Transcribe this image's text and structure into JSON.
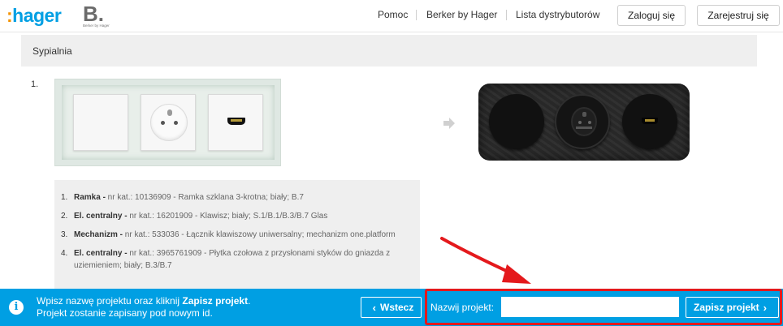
{
  "header": {
    "brand_hager": "hager",
    "brand_b": "B.",
    "brand_b_sub": "Berker by Hager",
    "nav": [
      "Pomoc",
      "Berker by Hager",
      "Lista dystrybutorów"
    ],
    "login_label": "Zaloguj się",
    "register_label": "Zarejestruj się"
  },
  "section": {
    "title": "Sypialnia",
    "item_number": "1."
  },
  "parts": [
    {
      "num": "1.",
      "type": "Ramka -",
      "desc": " nr kat.: 10136909 - Ramka szklana 3-krotna; biały; B.7"
    },
    {
      "num": "2.",
      "type": "El. centralny -",
      "desc": " nr kat.: 16201909 - Klawisz; biały; S.1/B.1/B.3/B.7 Glas"
    },
    {
      "num": "3.",
      "type": "Mechanizm -",
      "desc": " nr kat.: 533036 - Łącznik klawiszowy uniwersalny; mechanizm one.platform"
    },
    {
      "num": "4.",
      "type": "El. centralny -",
      "desc": " nr kat.: 3965761909 - Płytka czołowa z przysłonami styków do gniazda z uziemieniem; biały; B.3/B.7"
    }
  ],
  "bottom_bar": {
    "info_line1_prefix": "Wpisz nazwę projektu oraz kliknij ",
    "info_line1_bold": "Zapisz projekt",
    "info_line1_suffix": ".",
    "info_line2": "Projekt zostanie zapisany pod nowym id.",
    "back_label": "Wstecz",
    "name_label": "Nazwij projekt:",
    "name_value": "",
    "save_label": "Zapisz projekt"
  },
  "colors": {
    "accent_blue": "#009fe3",
    "hager_orange": "#f39200",
    "highlight_red": "#e4191c"
  }
}
